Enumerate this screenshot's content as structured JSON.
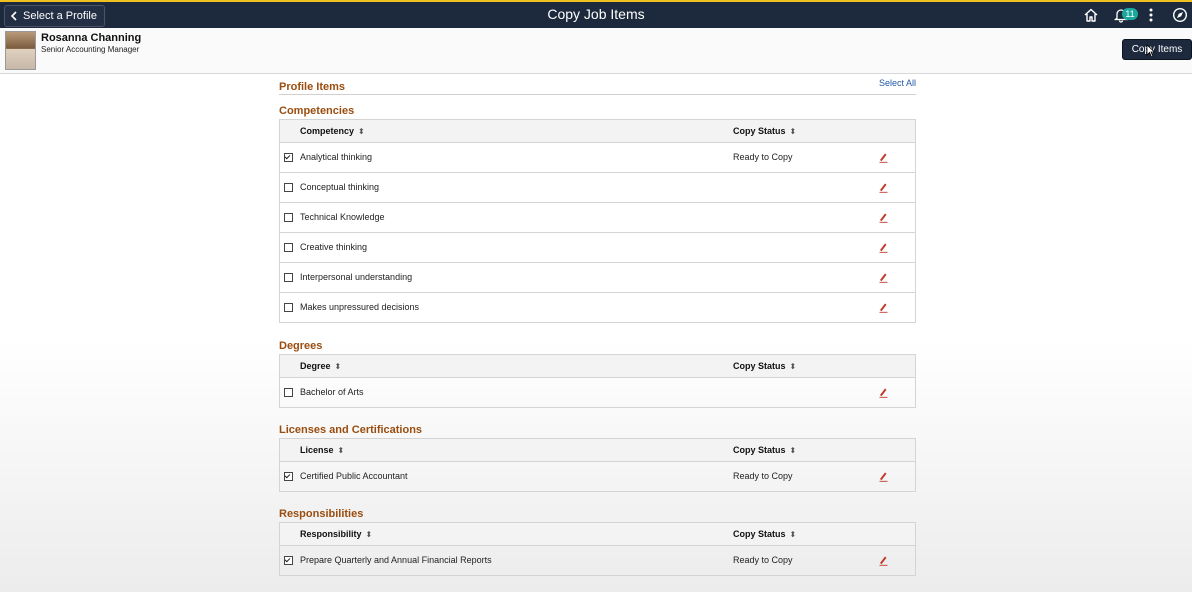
{
  "header": {
    "back_label": "Select a Profile",
    "title": "Copy Job Items",
    "notification_count": "11",
    "icons": [
      "home-icon",
      "bell-icon",
      "more-icon",
      "compass-icon"
    ]
  },
  "profile": {
    "name": "Rosanna Channing",
    "title": "Senior Accounting Manager"
  },
  "actions": {
    "copy_items_label": "Copy Items"
  },
  "content": {
    "profile_items_title": "Profile Items",
    "select_all_label": "Select All",
    "sections": [
      {
        "title": "Competencies",
        "col1": "Competency",
        "col2": "Copy Status",
        "rows": [
          {
            "label": "Analytical thinking",
            "status": "Ready to Copy",
            "checked": true
          },
          {
            "label": "Conceptual thinking",
            "status": "",
            "checked": false
          },
          {
            "label": "Technical Knowledge",
            "status": "",
            "checked": false
          },
          {
            "label": "Creative thinking",
            "status": "",
            "checked": false
          },
          {
            "label": "Interpersonal understanding",
            "status": "",
            "checked": false
          },
          {
            "label": "Makes unpressured decisions",
            "status": "",
            "checked": false
          }
        ]
      },
      {
        "title": "Degrees",
        "col1": "Degree",
        "col2": "Copy Status",
        "rows": [
          {
            "label": "Bachelor of Arts",
            "status": "",
            "checked": false
          }
        ]
      },
      {
        "title": "Licenses and Certifications",
        "col1": "License",
        "col2": "Copy Status",
        "rows": [
          {
            "label": "Certified Public Accountant",
            "status": "Ready to Copy",
            "checked": true
          }
        ]
      },
      {
        "title": "Responsibilities",
        "col1": "Responsibility",
        "col2": "Copy Status",
        "rows": [
          {
            "label": "Prepare Quarterly and Annual Financial Reports",
            "status": "Ready to Copy",
            "checked": true
          }
        ]
      }
    ]
  },
  "colors": {
    "header_bg": "#1d2a3e",
    "section_title": "#9a4d0e",
    "link": "#1f5aa6",
    "badge": "#1aa89c"
  }
}
